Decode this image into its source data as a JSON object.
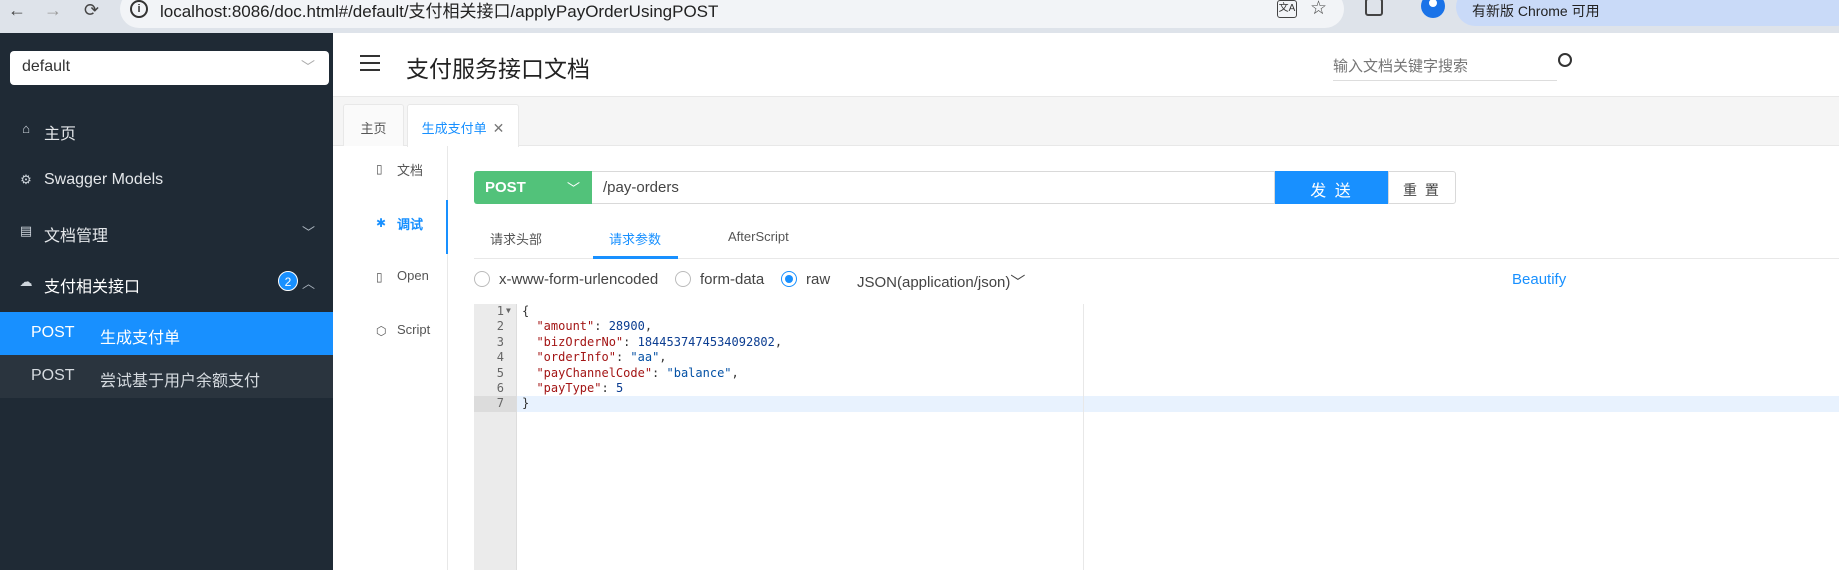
{
  "browser": {
    "url": "localhost:8086/doc.html#/default/支付相关接口/applyPayOrderUsingPOST",
    "update_label": "有新版 Chrome 可用"
  },
  "sidebar": {
    "group": "default",
    "items": [
      {
        "label": "主页",
        "icon": "home-icon"
      },
      {
        "label": "Swagger Models",
        "icon": "models-icon"
      },
      {
        "label": "文档管理",
        "icon": "doc-manage-icon"
      },
      {
        "label": "支付相关接口",
        "icon": "cloud-icon",
        "badge": "2"
      }
    ],
    "apis": [
      {
        "method": "POST",
        "name": "生成支付单"
      },
      {
        "method": "POST",
        "name": "尝试基于用户余额支付"
      }
    ]
  },
  "header": {
    "title": "支付服务接口文档",
    "search_placeholder": "输入文档关键字搜索"
  },
  "tabs": [
    {
      "label": "主页"
    },
    {
      "label": "生成支付单"
    }
  ],
  "side_tabs": [
    {
      "label": "文档"
    },
    {
      "label": "调试"
    },
    {
      "label": "Open"
    },
    {
      "label": "Script"
    }
  ],
  "request": {
    "method": "POST",
    "path": "/pay-orders",
    "send_label": "发 送",
    "reset_label": "重 置"
  },
  "sub_tabs": [
    {
      "label": "请求头部"
    },
    {
      "label": "请求参数"
    },
    {
      "label": "AfterScript"
    }
  ],
  "body_types": {
    "urlencoded": "x-www-form-urlencoded",
    "formdata": "form-data",
    "raw": "raw",
    "content_type": "JSON(application/json)",
    "beautify": "Beautify"
  },
  "editor": {
    "line_numbers": [
      "1",
      "2",
      "3",
      "4",
      "5",
      "6",
      "7"
    ],
    "lines": [
      {
        "k": "",
        "v": "{"
      },
      {
        "k": "\"amount\"",
        "v": "28900"
      },
      {
        "k": "\"bizOrderNo\"",
        "v": "1844537474534092802"
      },
      {
        "k": "\"orderInfo\"",
        "v": "\"aa\""
      },
      {
        "k": "\"payChannelCode\"",
        "v": "\"balance\""
      },
      {
        "k": "\"payType\"",
        "v": "5"
      },
      {
        "k": "",
        "v": "}"
      }
    ]
  }
}
